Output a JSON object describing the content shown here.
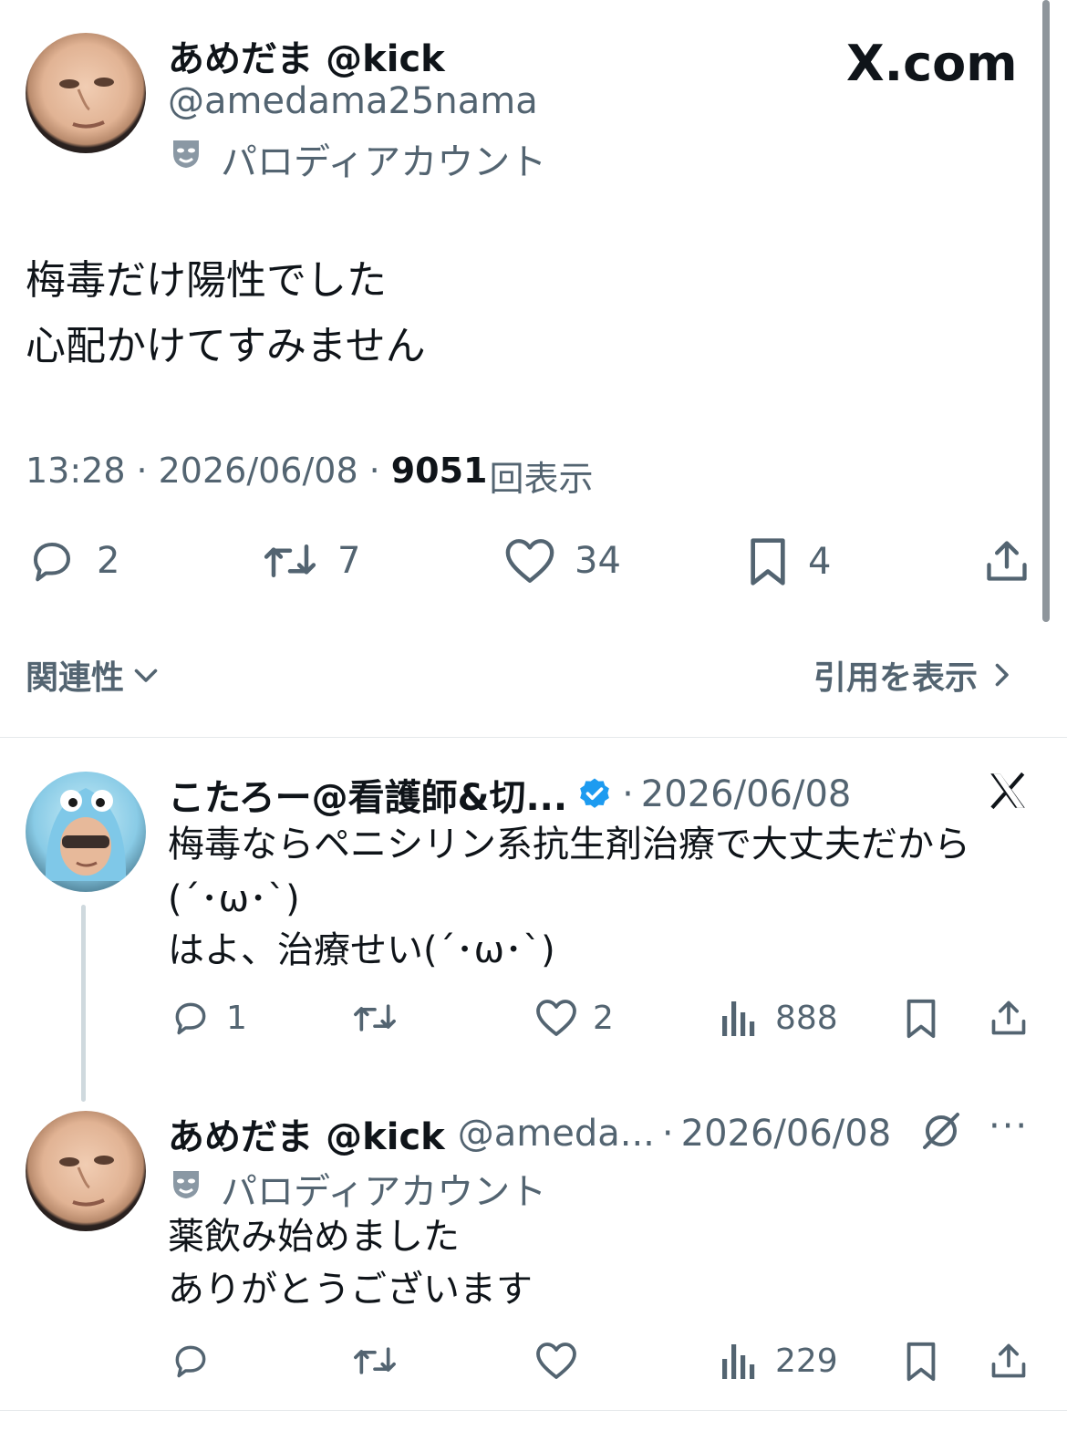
{
  "header": {
    "site_logo_text": "X.com"
  },
  "main_tweet": {
    "author_name": "あめだま @kick",
    "handle": "@amedama25nama",
    "parody_label": "パロディアカウント",
    "text_line1": "梅毒だけ陽性でした",
    "text_line2": "心配かけてすみません",
    "time": "13:28",
    "separator": "·",
    "date": "2026/06/08",
    "views_count": "9051",
    "views_label": "回表示",
    "replies": "2",
    "retweets": "7",
    "likes": "34",
    "bookmarks": "4"
  },
  "sort_bar": {
    "relevance_label": "関連性",
    "quotes_label": "引用を表示"
  },
  "reply1": {
    "author_name": "こたろー@看護師&切...",
    "separator": "·",
    "date": "2026/06/08",
    "text_line1": "梅毒ならペニシリン系抗生剤治療で大丈夫だから",
    "text_line2": "(´･ω･`)",
    "text_line3": "はよ、治療せい(´･ω･`)",
    "replies": "1",
    "likes": "2",
    "views": "888"
  },
  "reply2": {
    "author_name": "あめだま @kick",
    "handle": "@ameda...",
    "separator": "·",
    "date": "2026/06/08",
    "parody_label": "パロディアカウント",
    "more": "···",
    "text_line1": "薬飲み始めました",
    "text_line2": "ありがとうございます",
    "views": "229"
  },
  "colors": {
    "text": "#0f1419",
    "muted": "#536471",
    "verified": "#1d9bf0",
    "divider": "#e6e9eb"
  }
}
